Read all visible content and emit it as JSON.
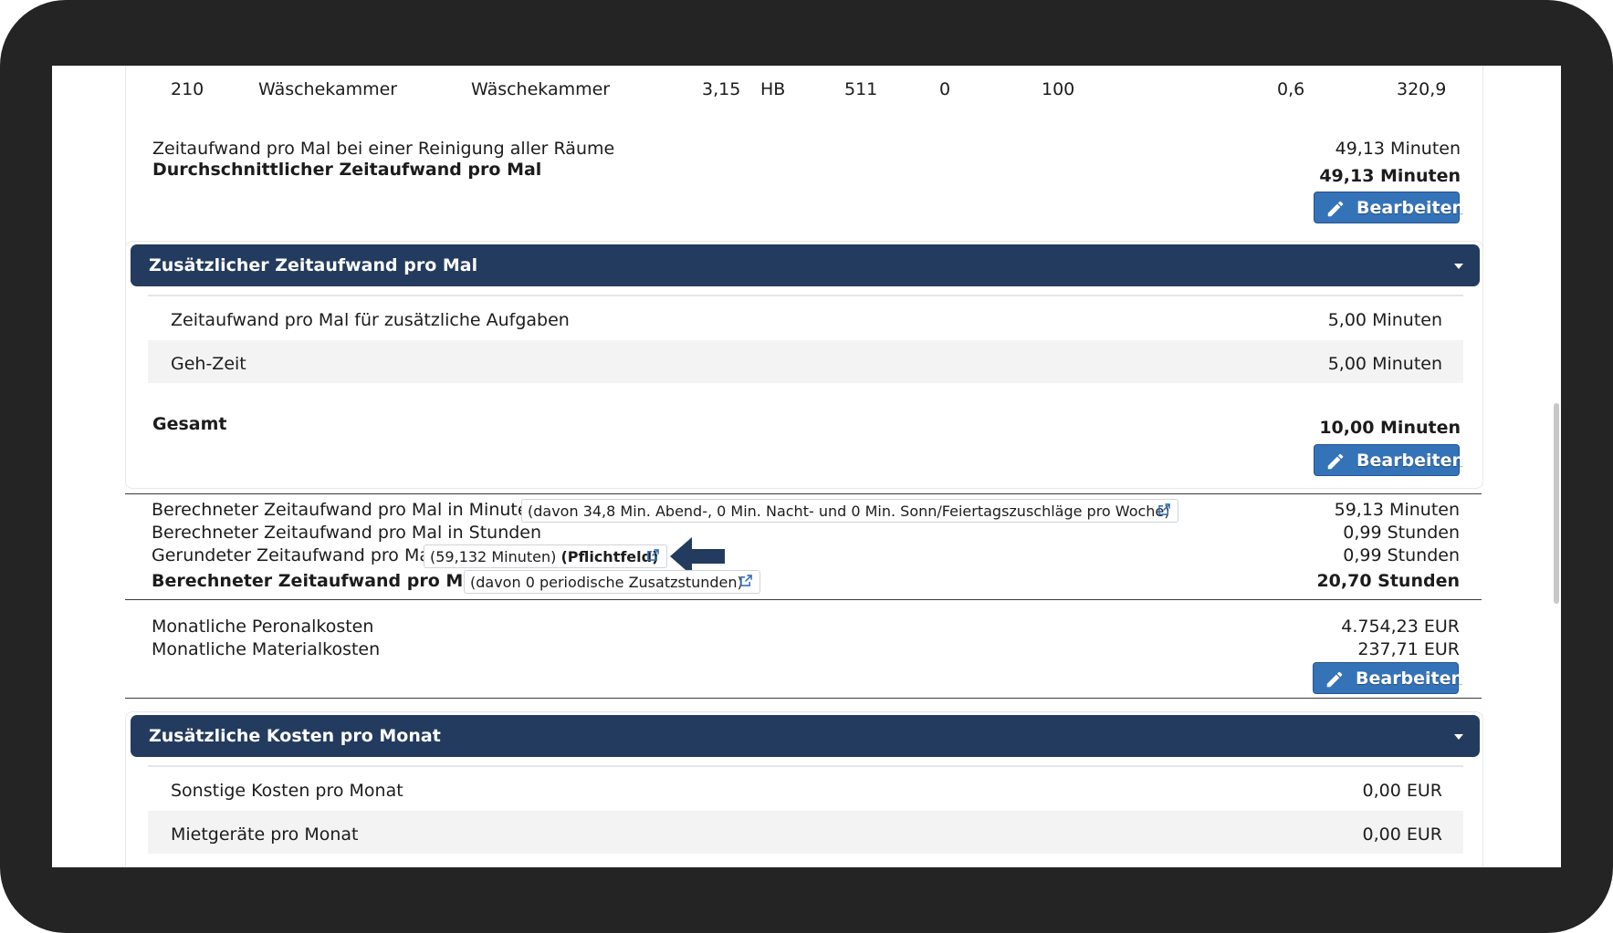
{
  "table_row": {
    "nr": "210",
    "name": "Wäschekammer",
    "type": "Wäschekammer",
    "area": "3,15",
    "code": "HB",
    "group": "511",
    "v1": "0",
    "v2": "100",
    "v3": "0,6",
    "v4": "320,9"
  },
  "summary": {
    "all_rooms_label": "Zeitaufwand pro Mal bei einer Reinigung aller Räume",
    "all_rooms_value": "49,13 Minuten",
    "avg_label": "Durchschnittlicher Zeitaufwand pro Mal",
    "avg_value": "49,13 Minuten"
  },
  "edit_label": "Bearbeiten",
  "additional_time": {
    "title": "Zusätzlicher Zeitaufwand pro Mal",
    "rows": [
      {
        "label": "Zeitaufwand pro Mal für zusätzliche Aufgaben",
        "value": "5,00 Minuten"
      },
      {
        "label": "Geh-Zeit",
        "value": "5,00 Minuten"
      }
    ],
    "total_label": "Gesamt",
    "total_value": "10,00 Minuten"
  },
  "calc": {
    "minutes_label": "Berechneter Zeitaufwand pro Mal in Minuten",
    "minutes_chip": "(davon 34,8 Min. Abend-, 0 Min. Nacht- und 0 Min. Sonn/Feiertagszuschläge pro Woche)",
    "minutes_value": "59,13 Minuten",
    "hours_label": "Berechneter Zeitaufwand pro Mal in Stunden",
    "hours_value": "0,99 Stunden",
    "rounded_label": "Gerundeter Zeitaufwand pro Mal",
    "rounded_chip": "(59,132 Minuten)",
    "rounded_chip_bold": "(Pflichtfeld)",
    "rounded_value": "0,99 Stunden",
    "month_label": "Berechneter Zeitaufwand pro Monat",
    "month_chip": "(davon 0 periodische Zusatzstunden)",
    "month_value": "20,70 Stunden"
  },
  "costs": {
    "personnel_label": "Monatliche Peronalkosten",
    "personnel_value": "4.754,23 EUR",
    "material_label": "Monatliche Materialkosten",
    "material_value": "237,71 EUR"
  },
  "additional_costs": {
    "title": "Zusätzliche Kosten pro Monat",
    "rows": [
      {
        "label": "Sonstige Kosten pro Monat",
        "value": "0,00 EUR"
      },
      {
        "label": "Mietgeräte pro Monat",
        "value": "0,00 EUR"
      }
    ]
  },
  "colors": {
    "header": "#233b5e",
    "button": "#3573b9",
    "arrow": "#233b5e"
  }
}
